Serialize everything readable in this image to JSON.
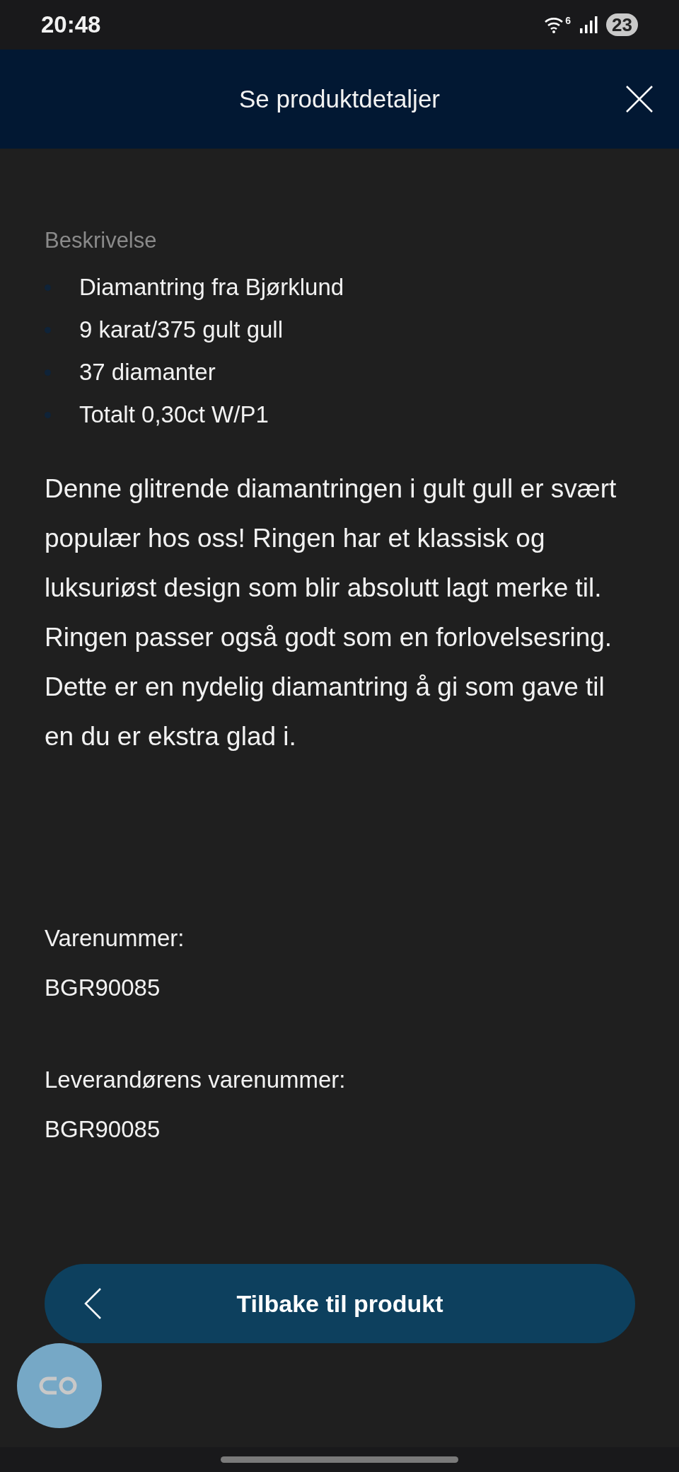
{
  "status_bar": {
    "time": "20:48",
    "wifi_label": "6",
    "battery": "23"
  },
  "header": {
    "title": "Se produktdetaljer"
  },
  "description": {
    "heading": "Beskrivelse",
    "bullets": [
      "Diamantring fra Bjørklund",
      "9 karat/375 gult gull",
      "37 diamanter",
      "Totalt 0,30ct W/P1"
    ],
    "text": "Denne glitrende diamantringen i gult gull er svært populær hos oss! Ringen har et klassisk og luksuriøst design som blir absolutt lagt merke til. Ringen passer også godt som en forlovelsesring. Dette er en nydelig diamantring å gi som gave til en du er ekstra glad i."
  },
  "fields": [
    {
      "label": "Varenummer:",
      "value": "BGR90085"
    },
    {
      "label": "Leverandørens varenummer:",
      "value": "BGR90085"
    }
  ],
  "back_button": {
    "label": "Tilbake til produkt"
  }
}
